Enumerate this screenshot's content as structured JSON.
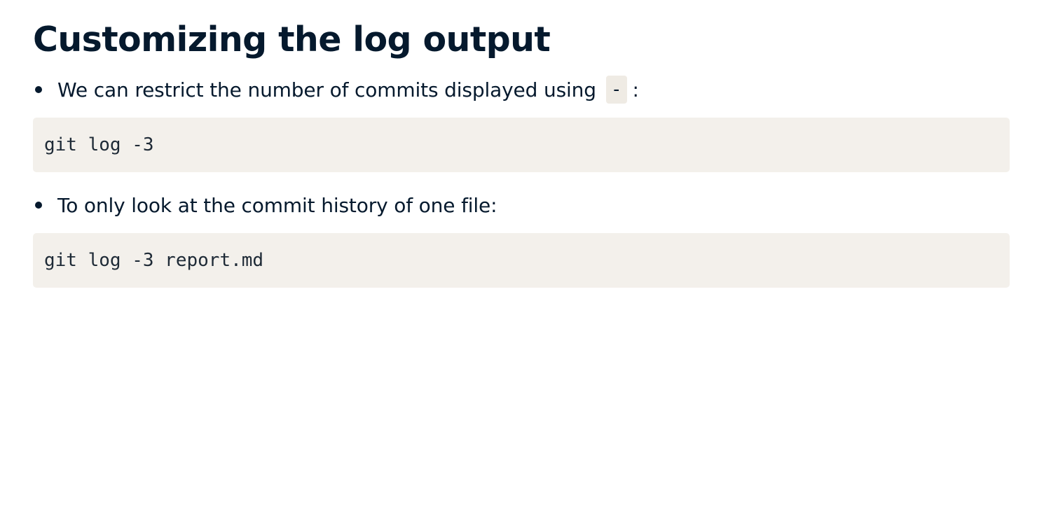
{
  "title": "Customizing the log output",
  "items": [
    {
      "text": "We can restrict the number of commits displayed using",
      "inline_code": "-",
      "suffix": ":"
    },
    {
      "text": "To only look at the commit history of one file:"
    }
  ],
  "code_blocks": [
    "git log -3",
    "git log -3 report.md"
  ]
}
